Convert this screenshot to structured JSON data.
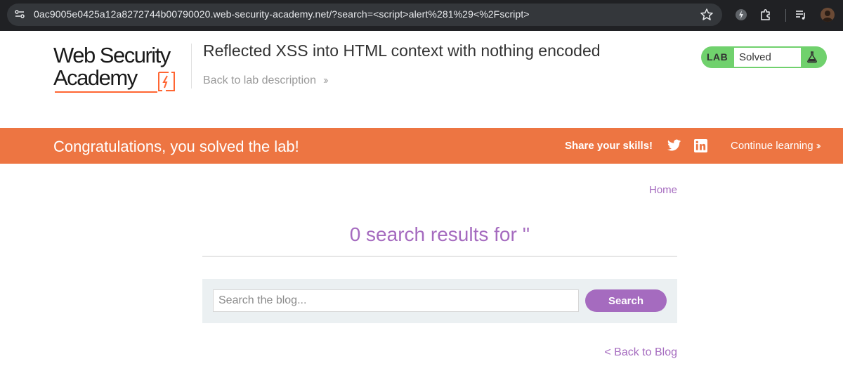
{
  "browser": {
    "url": "0ac9005e0425a12a8272744b00790020.web-security-academy.net/?search=<script>alert%281%29<%2Fscript>"
  },
  "header": {
    "logo_line1": "Web Security",
    "logo_line2": "Academy",
    "lab_title": "Reflected XSS into HTML context with nothing encoded",
    "back_to_description": "Back to lab description",
    "lab_tag": "LAB",
    "lab_status": "Solved"
  },
  "banner": {
    "message": "Congratulations, you solved the lab!",
    "share_label": "Share your skills!",
    "continue_label": "Continue learning"
  },
  "main": {
    "home_link": "Home",
    "results_heading": "0 search results for ''",
    "search_placeholder": "Search the blog...",
    "search_button": "Search",
    "back_to_blog": "< Back to Blog"
  },
  "colors": {
    "banner": "#ed7542",
    "accent_purple": "#a56bbf",
    "lab_green": "#70d16d",
    "chrome_dark": "#202124"
  },
  "icons": [
    "site-info-icon",
    "bookmark-star-icon",
    "extension-icon",
    "puzzle-icon",
    "media-queue-icon",
    "profile-avatar",
    "flask-icon",
    "twitter-icon",
    "linkedin-icon"
  ]
}
